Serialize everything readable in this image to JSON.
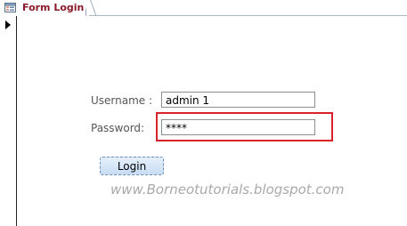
{
  "tab": {
    "icon": "form-icon",
    "title": "Form Login"
  },
  "form": {
    "username_label": "Username :",
    "username_value": "admin 1",
    "password_label": "Password:",
    "password_value": "****",
    "login_label": "Login"
  },
  "watermark": "www.Borneotutorials.blogspot.com",
  "colors": {
    "highlight": "#d8232a",
    "tab_title": "#8b1a2b"
  }
}
